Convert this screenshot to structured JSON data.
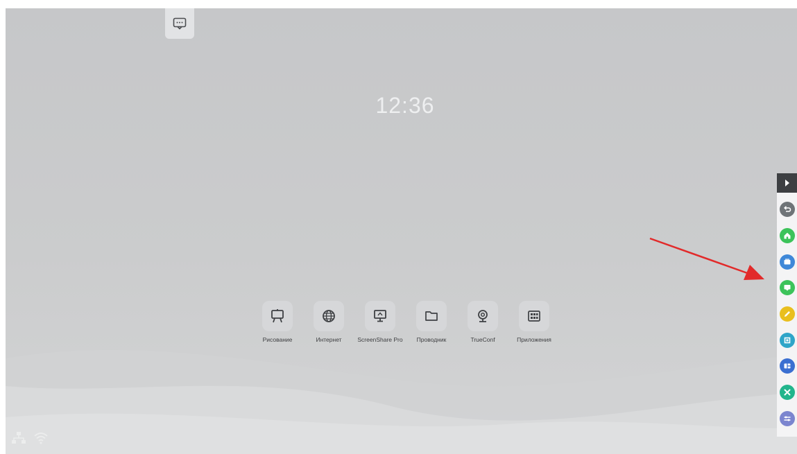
{
  "clock": {
    "time": "12:36"
  },
  "dock": {
    "apps": [
      {
        "label": "Рисование",
        "icon": "whiteboard-icon"
      },
      {
        "label": "Интернет",
        "icon": "globe-icon"
      },
      {
        "label": "ScreenShare Pro",
        "icon": "screen-share-icon"
      },
      {
        "label": "Проводник",
        "icon": "folder-icon"
      },
      {
        "label": "TrueConf",
        "icon": "webcam-icon"
      },
      {
        "label": "Приложения",
        "icon": "apps-grid-icon"
      }
    ]
  },
  "top_widget": {
    "icon": "message-icon"
  },
  "sidebar": {
    "toggle_icon": "expand-arrow-icon",
    "buttons": [
      {
        "icon": "back-icon",
        "color": "#6f7478"
      },
      {
        "icon": "home-icon",
        "color": "#3cc35a"
      },
      {
        "icon": "windows-icon",
        "color": "#3f88d8"
      },
      {
        "icon": "chat-icon",
        "color": "#3cc35a"
      },
      {
        "icon": "pen-icon",
        "color": "#e9bf1f"
      },
      {
        "icon": "screenshot-icon",
        "color": "#2fa5c8"
      },
      {
        "icon": "split-screen-icon",
        "color": "#3a6fd1"
      },
      {
        "icon": "tools-icon",
        "color": "#22b58c"
      },
      {
        "icon": "settings-icon",
        "color": "#7b85cf"
      }
    ]
  },
  "status_bar": {
    "icons": [
      "network-icon",
      "wifi-icon"
    ]
  },
  "colors": {
    "background": "#c8c9cb",
    "annotation_arrow": "#e22a2a",
    "clock_text": "#eeeff0"
  }
}
